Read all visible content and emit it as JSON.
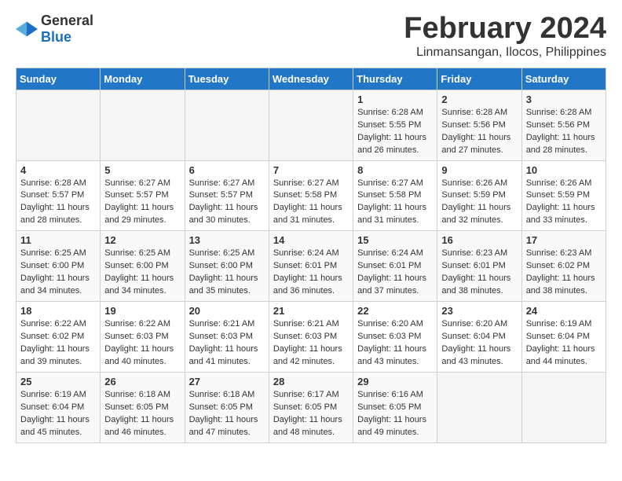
{
  "app": {
    "logo_general": "General",
    "logo_blue": "Blue",
    "title": "February 2024",
    "subtitle": "Linmansangan, Ilocos, Philippines"
  },
  "calendar": {
    "headers": [
      "Sunday",
      "Monday",
      "Tuesday",
      "Wednesday",
      "Thursday",
      "Friday",
      "Saturday"
    ],
    "weeks": [
      [
        {
          "day": "",
          "info": ""
        },
        {
          "day": "",
          "info": ""
        },
        {
          "day": "",
          "info": ""
        },
        {
          "day": "",
          "info": ""
        },
        {
          "day": "1",
          "info": "Sunrise: 6:28 AM\nSunset: 5:55 PM\nDaylight: 11 hours and 26 minutes."
        },
        {
          "day": "2",
          "info": "Sunrise: 6:28 AM\nSunset: 5:56 PM\nDaylight: 11 hours and 27 minutes."
        },
        {
          "day": "3",
          "info": "Sunrise: 6:28 AM\nSunset: 5:56 PM\nDaylight: 11 hours and 28 minutes."
        }
      ],
      [
        {
          "day": "4",
          "info": "Sunrise: 6:28 AM\nSunset: 5:57 PM\nDaylight: 11 hours and 28 minutes."
        },
        {
          "day": "5",
          "info": "Sunrise: 6:27 AM\nSunset: 5:57 PM\nDaylight: 11 hours and 29 minutes."
        },
        {
          "day": "6",
          "info": "Sunrise: 6:27 AM\nSunset: 5:57 PM\nDaylight: 11 hours and 30 minutes."
        },
        {
          "day": "7",
          "info": "Sunrise: 6:27 AM\nSunset: 5:58 PM\nDaylight: 11 hours and 31 minutes."
        },
        {
          "day": "8",
          "info": "Sunrise: 6:27 AM\nSunset: 5:58 PM\nDaylight: 11 hours and 31 minutes."
        },
        {
          "day": "9",
          "info": "Sunrise: 6:26 AM\nSunset: 5:59 PM\nDaylight: 11 hours and 32 minutes."
        },
        {
          "day": "10",
          "info": "Sunrise: 6:26 AM\nSunset: 5:59 PM\nDaylight: 11 hours and 33 minutes."
        }
      ],
      [
        {
          "day": "11",
          "info": "Sunrise: 6:25 AM\nSunset: 6:00 PM\nDaylight: 11 hours and 34 minutes."
        },
        {
          "day": "12",
          "info": "Sunrise: 6:25 AM\nSunset: 6:00 PM\nDaylight: 11 hours and 34 minutes."
        },
        {
          "day": "13",
          "info": "Sunrise: 6:25 AM\nSunset: 6:00 PM\nDaylight: 11 hours and 35 minutes."
        },
        {
          "day": "14",
          "info": "Sunrise: 6:24 AM\nSunset: 6:01 PM\nDaylight: 11 hours and 36 minutes."
        },
        {
          "day": "15",
          "info": "Sunrise: 6:24 AM\nSunset: 6:01 PM\nDaylight: 11 hours and 37 minutes."
        },
        {
          "day": "16",
          "info": "Sunrise: 6:23 AM\nSunset: 6:01 PM\nDaylight: 11 hours and 38 minutes."
        },
        {
          "day": "17",
          "info": "Sunrise: 6:23 AM\nSunset: 6:02 PM\nDaylight: 11 hours and 38 minutes."
        }
      ],
      [
        {
          "day": "18",
          "info": "Sunrise: 6:22 AM\nSunset: 6:02 PM\nDaylight: 11 hours and 39 minutes."
        },
        {
          "day": "19",
          "info": "Sunrise: 6:22 AM\nSunset: 6:03 PM\nDaylight: 11 hours and 40 minutes."
        },
        {
          "day": "20",
          "info": "Sunrise: 6:21 AM\nSunset: 6:03 PM\nDaylight: 11 hours and 41 minutes."
        },
        {
          "day": "21",
          "info": "Sunrise: 6:21 AM\nSunset: 6:03 PM\nDaylight: 11 hours and 42 minutes."
        },
        {
          "day": "22",
          "info": "Sunrise: 6:20 AM\nSunset: 6:03 PM\nDaylight: 11 hours and 43 minutes."
        },
        {
          "day": "23",
          "info": "Sunrise: 6:20 AM\nSunset: 6:04 PM\nDaylight: 11 hours and 43 minutes."
        },
        {
          "day": "24",
          "info": "Sunrise: 6:19 AM\nSunset: 6:04 PM\nDaylight: 11 hours and 44 minutes."
        }
      ],
      [
        {
          "day": "25",
          "info": "Sunrise: 6:19 AM\nSunset: 6:04 PM\nDaylight: 11 hours and 45 minutes."
        },
        {
          "day": "26",
          "info": "Sunrise: 6:18 AM\nSunset: 6:05 PM\nDaylight: 11 hours and 46 minutes."
        },
        {
          "day": "27",
          "info": "Sunrise: 6:18 AM\nSunset: 6:05 PM\nDaylight: 11 hours and 47 minutes."
        },
        {
          "day": "28",
          "info": "Sunrise: 6:17 AM\nSunset: 6:05 PM\nDaylight: 11 hours and 48 minutes."
        },
        {
          "day": "29",
          "info": "Sunrise: 6:16 AM\nSunset: 6:05 PM\nDaylight: 11 hours and 49 minutes."
        },
        {
          "day": "",
          "info": ""
        },
        {
          "day": "",
          "info": ""
        }
      ]
    ]
  }
}
